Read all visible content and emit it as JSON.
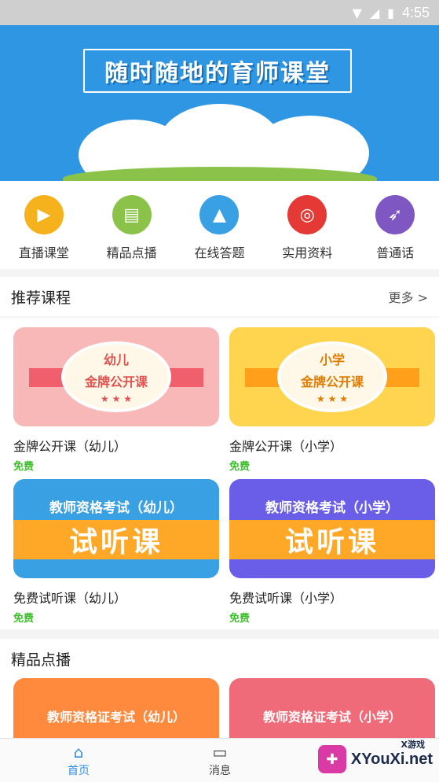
{
  "status_bar": {
    "time": "4:55",
    "icons": [
      "wifi-icon",
      "signal-icon",
      "battery-icon"
    ]
  },
  "banner": {
    "title": "随时随地的育师课堂"
  },
  "categories": [
    {
      "label": "直播课堂",
      "icon": "tv-icon",
      "color": "#f5b21c"
    },
    {
      "label": "精品点播",
      "icon": "book-icon",
      "color": "#8bc34a"
    },
    {
      "label": "在线答题",
      "icon": "mountain-icon",
      "color": "#3aa0e4"
    },
    {
      "label": "实用资料",
      "icon": "target-icon",
      "color": "#e53935"
    },
    {
      "label": "普通话",
      "icon": "rocket-icon",
      "color": "#7e57c2"
    }
  ],
  "recommended": {
    "heading": "推荐课程",
    "more": "更多 >",
    "courses": [
      {
        "name": "金牌公开课（幼儿）",
        "price": "免费",
        "badge_line1": "幼儿",
        "badge_line2": "金牌公开课",
        "bg": "#f9b8b8"
      },
      {
        "name": "金牌公开课（小学）",
        "price": "免费",
        "badge_line1": "小学",
        "badge_line2": "金牌公开课",
        "bg": "#ffd54f"
      },
      {
        "name": "免费试听课（幼儿）",
        "price": "免费",
        "top": "教师资格考试（幼儿）",
        "band": "试听课",
        "bg": "#3aa0e4"
      },
      {
        "name": "免费试听课（小学）",
        "price": "免费",
        "top": "教师资格考试（小学）",
        "band": "试听课",
        "bg": "#6a5de8"
      }
    ]
  },
  "vod": {
    "heading": "精品点播",
    "items": [
      {
        "text": "教师资格证考试（幼儿）",
        "bg": "#ff8a3d"
      },
      {
        "text": "教师资格证考试（小学）",
        "bg": "#f06b7a"
      }
    ]
  },
  "bottom_nav": {
    "items": [
      {
        "label": "首页",
        "icon": "home-icon",
        "active": true
      },
      {
        "label": "消息",
        "icon": "message-icon",
        "active": false
      }
    ]
  },
  "watermark": {
    "text": "XYouXi.net",
    "small": "X游戏"
  }
}
